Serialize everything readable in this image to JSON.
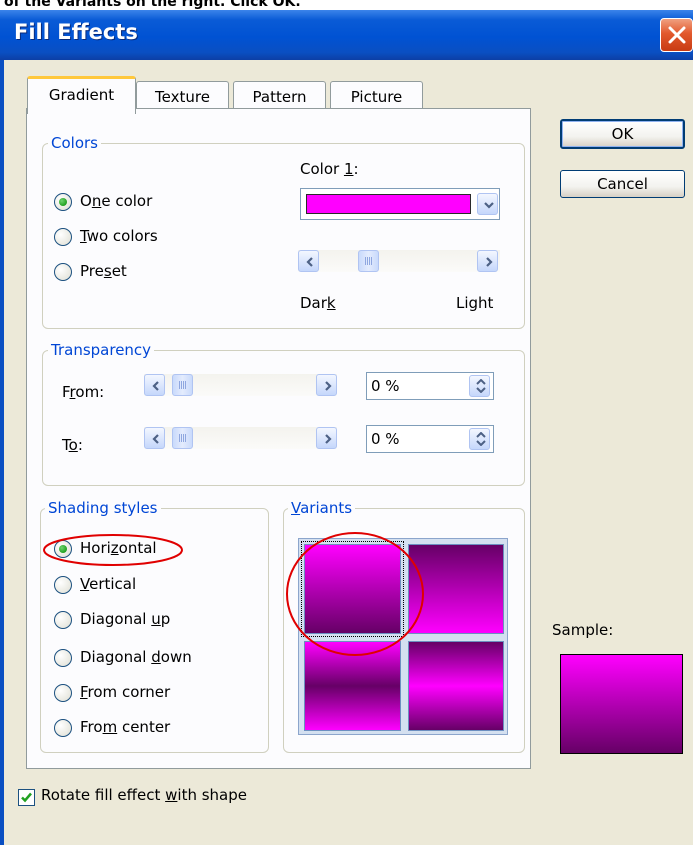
{
  "caption_fragment": "of the Variants on the right. Click OK.",
  "window": {
    "title": "Fill Effects"
  },
  "tabs": [
    {
      "label": "Gradient",
      "active": true
    },
    {
      "label": "Texture",
      "active": false
    },
    {
      "label": "Pattern",
      "active": false
    },
    {
      "label": "Picture",
      "active": false
    }
  ],
  "colors": {
    "legend": "Colors",
    "options": [
      {
        "pre": "O",
        "u": "n",
        "post": "e color",
        "checked": true
      },
      {
        "pre": "",
        "u": "T",
        "post": "wo colors",
        "checked": false
      },
      {
        "pre": "Pre",
        "u": "s",
        "post": "et",
        "checked": false
      }
    ],
    "color1_pre": "Color ",
    "color1_u": "1",
    "color1_post": ":",
    "color1_value": "#ff00ff",
    "dark_pre": "Dar",
    "dark_u": "k",
    "light_label": "Light"
  },
  "transparency": {
    "legend": "Transparency",
    "from_pre": "F",
    "from_u": "r",
    "from_post": "om:",
    "from_value": "0 %",
    "to_pre": "T",
    "to_u": "o",
    "to_post": ":",
    "to_value": "0 %"
  },
  "shading": {
    "legend": "Shading styles",
    "options": [
      {
        "pre": "Hori",
        "u": "z",
        "post": "ontal",
        "checked": true
      },
      {
        "pre": "",
        "u": "V",
        "post": "ertical",
        "checked": false
      },
      {
        "pre": "Diagonal ",
        "u": "u",
        "post": "p",
        "checked": false
      },
      {
        "pre": "Diagonal ",
        "u": "d",
        "post": "own",
        "checked": false
      },
      {
        "pre": "",
        "u": "F",
        "post": "rom corner",
        "checked": false
      },
      {
        "pre": "Fro",
        "u": "m",
        "post": " center",
        "checked": false
      }
    ]
  },
  "variants": {
    "legend_u": "V",
    "legend_post": "ariants"
  },
  "buttons": {
    "ok": "OK",
    "cancel": "Cancel"
  },
  "sample": {
    "label": "Sample:"
  },
  "rotate": {
    "pre": "Rotate fill effect ",
    "u": "w",
    "post": "ith shape",
    "checked": true
  },
  "accent_colors": {
    "gradient_light": "#ff00ff",
    "gradient_dark": "#660066",
    "annotation": "#e00000"
  }
}
